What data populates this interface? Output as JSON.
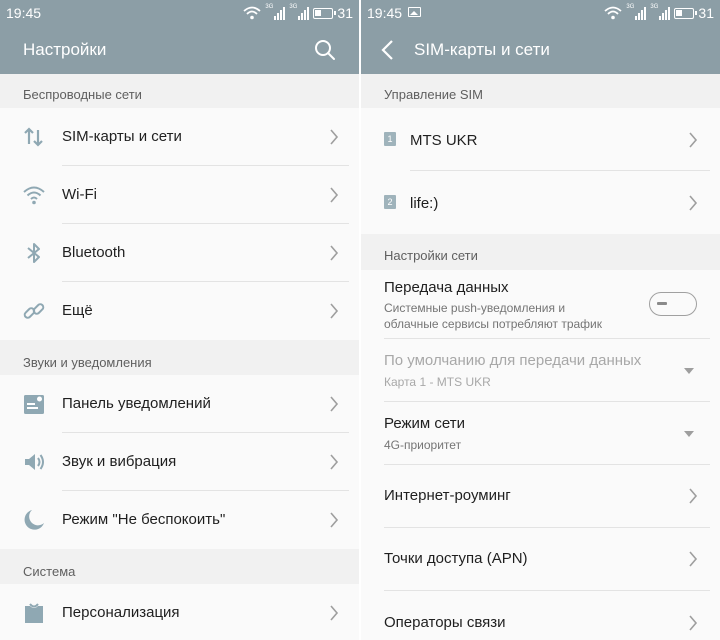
{
  "status_bar": {
    "time": "19:45",
    "network_tag_1": "3G",
    "network_tag_2": "3G",
    "battery": "31"
  },
  "left": {
    "title": "Настройки",
    "sections": {
      "wireless": "Беспроводные сети",
      "sounds": "Звуки и уведомления",
      "system": "Система"
    },
    "items": [
      {
        "label": "SIM-карты и сети",
        "icon": "sim-networks-icon"
      },
      {
        "label": "Wi-Fi",
        "icon": "wifi-icon"
      },
      {
        "label": "Bluetooth",
        "icon": "bluetooth-icon"
      },
      {
        "label": "Ещё",
        "icon": "link-icon"
      },
      {
        "label": "Панель уведомлений",
        "icon": "notification-panel-icon"
      },
      {
        "label": "Звук и вибрация",
        "icon": "speaker-icon"
      },
      {
        "label": "Режим \"Не беспокоить\"",
        "icon": "moon-icon"
      },
      {
        "label": "Персонализация",
        "icon": "personalization-icon"
      }
    ]
  },
  "right": {
    "title": "SIM-карты и сети",
    "sections": {
      "sim_management": "Управление SIM",
      "network_settings": "Настройки сети"
    },
    "sims": [
      {
        "badge": "1",
        "name": "MTS UKR"
      },
      {
        "badge": "2",
        "name": "life:)"
      }
    ],
    "data_transfer": {
      "title": "Передача данных",
      "sub_line1": "Системные push-уведомления и",
      "sub_line2": "облачные сервисы потребляют трафик",
      "enabled": false
    },
    "default_data": {
      "title": "По умолчанию для передачи данных",
      "value": "Карта 1 -  MTS UKR"
    },
    "network_mode": {
      "title": "Режим сети",
      "value": "4G-приоритет"
    },
    "roaming": "Интернет-роуминг",
    "apn": "Точки доступа (APN)",
    "operators": "Операторы связи"
  },
  "colors": {
    "header": "#8c9ea6",
    "section_bg": "#f1f1f1",
    "icon": "#8fa8b3"
  }
}
